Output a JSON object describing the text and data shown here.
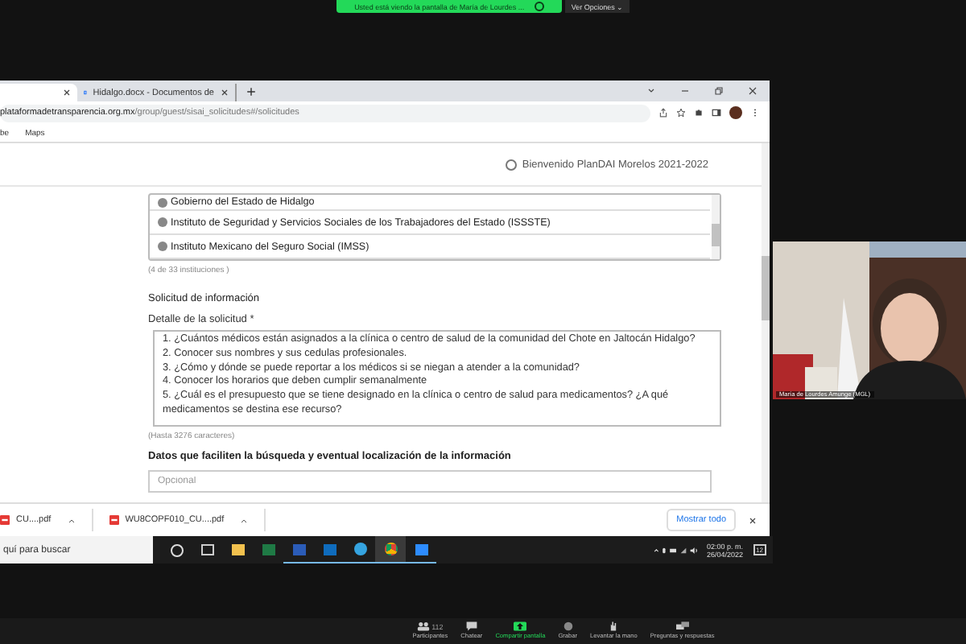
{
  "zoom_banner": {
    "text": "Usted está viendo la pantalla de María de Lourdes ...",
    "options": "Ver Opciones ⌄"
  },
  "browser": {
    "tabs": [
      {
        "selected": true
      },
      {
        "label": "Hidalgo.docx - Documentos de",
        "selected": false
      }
    ],
    "address": {
      "host": "plataformadetransparencia.org.mx",
      "path": "/group/guest/sisai_solicitudes#/solicitudes"
    },
    "bookmarks": [
      "be",
      "Maps"
    ]
  },
  "page": {
    "welcome": "Bienvenido PlanDAI Morelos 2021-2022",
    "institutions": [
      {
        "name": "Gobierno del Estado de Hidalgo"
      },
      {
        "name": "Instituto de Seguridad y Servicios Sociales de los Trabajadores del Estado (ISSSTE)"
      },
      {
        "name": "Instituto Mexicano del Seguro Social (IMSS)"
      }
    ],
    "institution_count": "(4 de 33 instituciones )",
    "section_title": "Solicitud de información",
    "detail_label": "Detalle de la solicitud *",
    "detail_lines": [
      "1. ¿Cuántos médicos están asignados a la clínica o centro de salud de la comunidad del Chote en Jaltocán Hidalgo?",
      "2. Conocer sus nombres y sus cedulas profesionales.",
      "3. ¿Cómo y dónde se puede reportar a los médicos si se niegan a atender a la comunidad?",
      "4. Conocer los horarios que deben cumplir semanalmente",
      "5. ¿Cuál es el presupuesto que se tiene designado en la clínica o centro de salud para medicamentos? ¿A qué medicamentos se destina ese recurso?"
    ],
    "detail_limit": "(Hasta 3276 caracteres)",
    "extra_label": "Datos que faciliten la búsqueda y eventual localización de la información",
    "extra_placeholder": "Opcional"
  },
  "downloads": {
    "items": [
      "CU....pdf",
      "WU8COPF010_CU....pdf"
    ],
    "show_all": "Mostrar todo"
  },
  "taskbar": {
    "search_placeholder": "quí para buscar",
    "time": "02:00 p. m.",
    "date": "26/04/2022",
    "notifications": "12"
  },
  "video": {
    "name": "María de Lourdes Amunge (MGL)"
  },
  "zoom_toolbar": [
    {
      "label": "Participantes",
      "kind": "participants",
      "count": "112"
    },
    {
      "label": "Chatear",
      "kind": "chat"
    },
    {
      "label": "Compartir pantalla",
      "kind": "share"
    },
    {
      "label": "Grabar",
      "kind": "record"
    },
    {
      "label": "Levantar la mano",
      "kind": "hand"
    },
    {
      "label": "Preguntas y respuestas",
      "kind": "qa"
    }
  ]
}
